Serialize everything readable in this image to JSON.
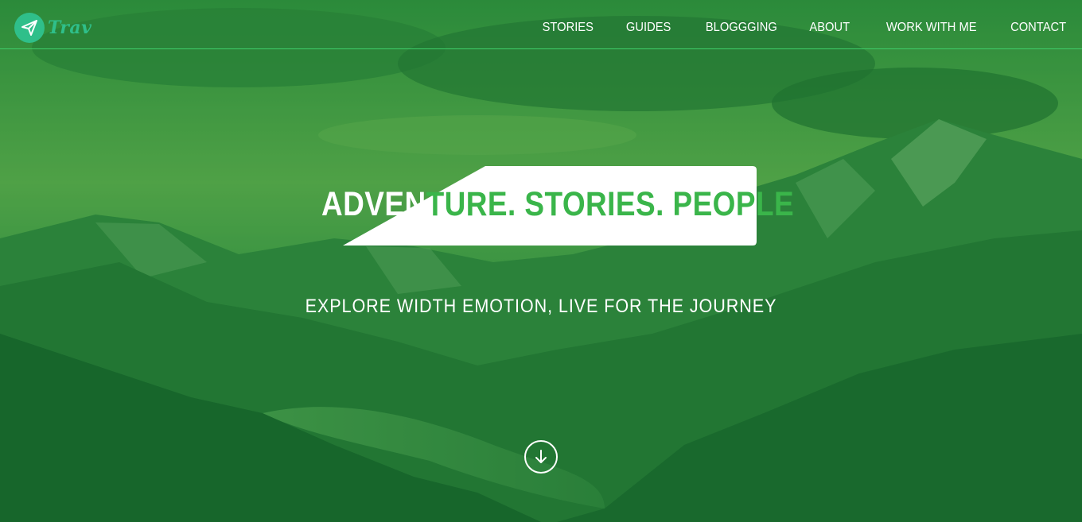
{
  "brand": {
    "name": "Trav",
    "logo_icon": "paper-plane-icon",
    "color": "#2fbf8a"
  },
  "nav": {
    "items": [
      {
        "label": "STORIES"
      },
      {
        "label": "GUIDES"
      },
      {
        "label": "BLOGGGING"
      },
      {
        "label": "ABOUT"
      },
      {
        "label": "WORK WITH ME"
      },
      {
        "label": "CONTACT"
      }
    ]
  },
  "hero": {
    "headline_part1": "ADVEN",
    "headline_part2": "TURE. STORIES. PEOPLE",
    "subtitle": "EXPLORE WIDTH EMOTION, LIVE FOR THE JOURNEY",
    "scroll_icon": "arrow-down-circle-icon"
  },
  "colors": {
    "overlay": "#1f7a3c",
    "accent": "#3ab54a",
    "nav_divider": "#3fcf6b"
  }
}
